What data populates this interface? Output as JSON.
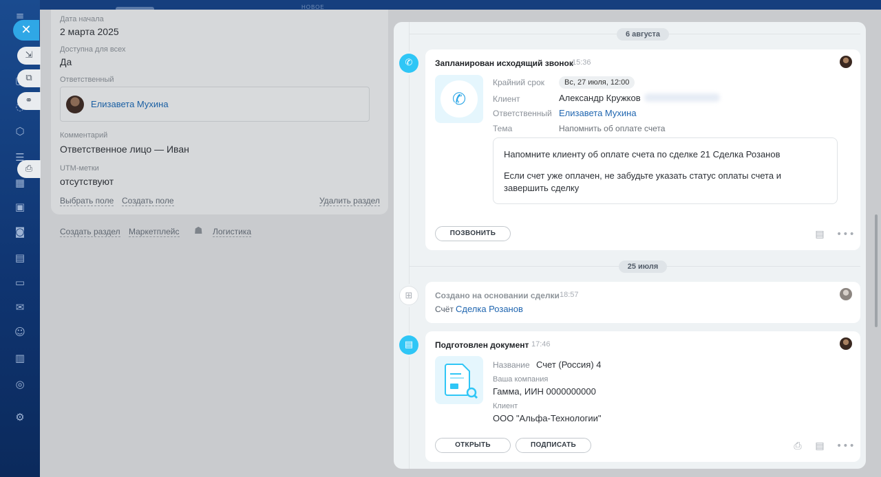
{
  "topbar": {
    "new_label": "НОВОЕ"
  },
  "left_panel": {
    "start_date_label": "Дата начала",
    "start_date_value": "2 марта 2025",
    "available_label": "Доступна для всех",
    "available_value": "Да",
    "responsible_label": "Ответственный",
    "responsible_name": "Елизавета Мухина",
    "comment_label": "Комментарий",
    "comment_value": "Ответственное лицо — Иван",
    "utm_label": "UTM-метки",
    "utm_value": "отсутствуют",
    "select_field": "Выбрать поле",
    "create_field": "Создать поле",
    "delete_section": "Удалить раздел",
    "create_section": "Создать раздел",
    "marketplace": "Маркетплейс",
    "logistics": "Логистика"
  },
  "timeline": {
    "date1": "6 августа",
    "date2": "25 июля",
    "call": {
      "title": "Запланирован исходящий звонок",
      "time": "15:36",
      "deadline_label": "Крайний срок",
      "deadline_value": "Вс, 27 июля, 12:00",
      "client_label": "Клиент",
      "client_value": "Александр Кружков",
      "responsible_label": "Ответственный",
      "responsible_value": "Елизавета Мухина",
      "topic_label": "Тема",
      "topic_value": "Напомнить об оплате счета",
      "note_line1": "Напомните клиенту об оплате счета по сделке 21 Сделка Розанов",
      "note_line2": "Если счет уже оплачен, не забудьте указать статус оплаты счета и завершить сделку",
      "call_button": "ПОЗВОНИТЬ"
    },
    "created": {
      "title": "Создано на основании сделки",
      "time": "18:57",
      "prefix": "Счёт",
      "link": "Сделка Розанов"
    },
    "document": {
      "title": "Подготовлен документ",
      "time": "17:46",
      "name_label": "Название",
      "name_value": "Счет (Россия) 4",
      "company_label": "Ваша компания",
      "company_value": "Гамма, ИИН 0000000000",
      "client_label": "Клиент",
      "client_value": "ООО \"Альфа-Технологии\"",
      "open_button": "ОТКРЫТЬ",
      "sign_button": "ПОДПИСАТЬ"
    }
  },
  "colors": {
    "accent": "#2fc6f6",
    "link": "#2066b0",
    "close": "#2fa7e6"
  }
}
